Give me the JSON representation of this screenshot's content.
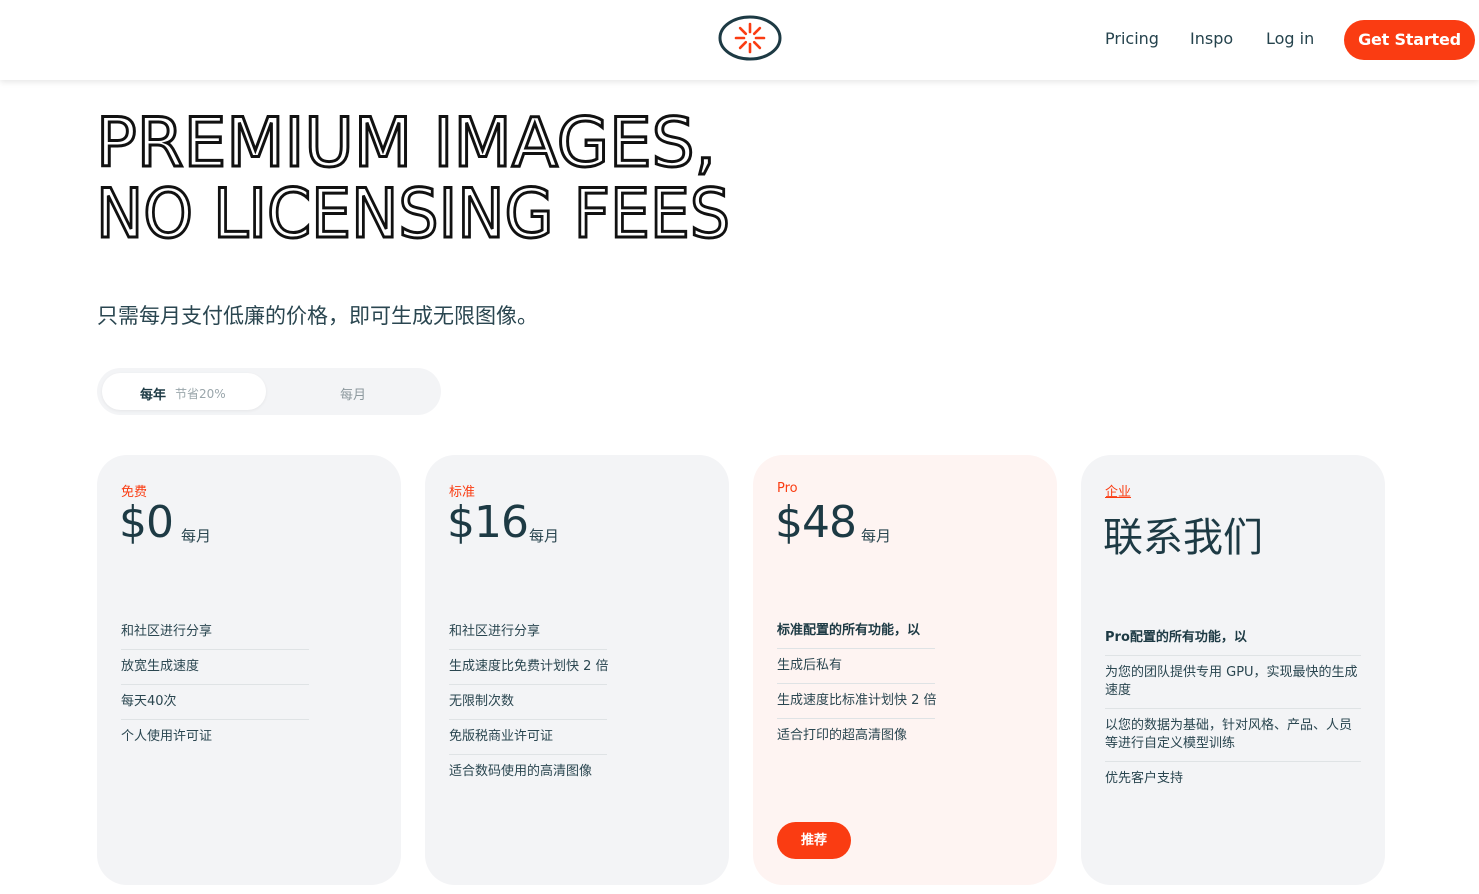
{
  "nav": {
    "pricing": "Pricing",
    "inspo": "Inspo",
    "login": "Log in",
    "cta": "Get Started"
  },
  "hero": {
    "line1": "PREMIUM IMAGES,",
    "line2": "NO LICENSING FEES"
  },
  "subtitle": "只需每月支付低廉的价格，即可生成无限图像。",
  "billing_toggle": {
    "yearly": "每年",
    "yearly_badge": "节省20%",
    "monthly": "每月",
    "selected": "每年"
  },
  "plans": [
    {
      "tier": "免费",
      "price": "$0",
      "period": "每月",
      "features": [
        "和社区进行分享",
        "放宽生成速度",
        "每天40次",
        "个人使用许可证"
      ]
    },
    {
      "tier": "标准",
      "price": "$16",
      "period": "每月",
      "features": [
        "和社区进行分享",
        "生成速度比免费计划快 2 倍",
        "无限制次数",
        "免版税商业许可证",
        "适合数码使用的高清图像"
      ]
    },
    {
      "tier": "Pro",
      "price": "$48",
      "period": "每月",
      "features_heading": "标准配置的所有功能，以",
      "features": [
        "生成后私有",
        "生成速度比标准计划快 2 倍",
        "适合打印的超高清图像"
      ],
      "badge": "推荐"
    },
    {
      "tier": "企业",
      "price": "联系我们",
      "features_heading": "Pro配置的所有功能，以",
      "features": [
        "为您的团队提供专用 GPU，实现最快的生成速度",
        "以您的数据为基础，针对风格、产品、人员等进行自定义模型训练",
        "优先客户支持"
      ]
    }
  ],
  "colors": {
    "accent": "#fa3c12",
    "text": "#1d3a44",
    "card_bg": "#f3f4f6",
    "pro_card_bg": "#fef4f2"
  }
}
